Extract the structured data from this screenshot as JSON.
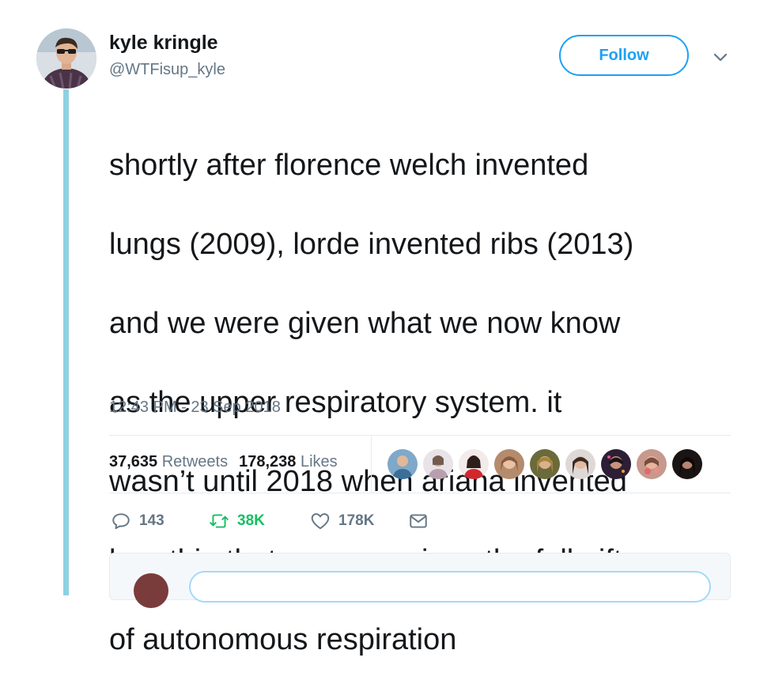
{
  "tweet": {
    "author_name": "kyle kringle",
    "author_handle": "@WTFisup_kyle",
    "follow_label": "Follow",
    "lines": [
      "shortly after florence welch invented",
      "lungs (2009), lorde invented ribs (2013)",
      "and we were given what we now know",
      "as the upper respiratory system. it",
      "wasn’t until 2018 when ariana invented",
      "breathin that we were given the full gift",
      "of autonomous respiration"
    ],
    "timestamp": "12:43 PM - 23 Sep 2018"
  },
  "stats": {
    "retweets_count": "37,635",
    "retweets_label": "Retweets",
    "likes_count": "178,238",
    "likes_label": "Likes"
  },
  "actions": {
    "replies": "143",
    "retweets": "38K",
    "likes": "178K"
  },
  "icons": {
    "reply": "reply-icon",
    "retweet": "retweet-icon",
    "like": "heart-icon",
    "dm": "envelope-icon",
    "caret": "chevron-down-icon"
  },
  "colors": {
    "accent": "#1da1f2",
    "retweet_green": "#17bf63",
    "muted": "#657786",
    "thread_line": "#8ed0e4"
  }
}
